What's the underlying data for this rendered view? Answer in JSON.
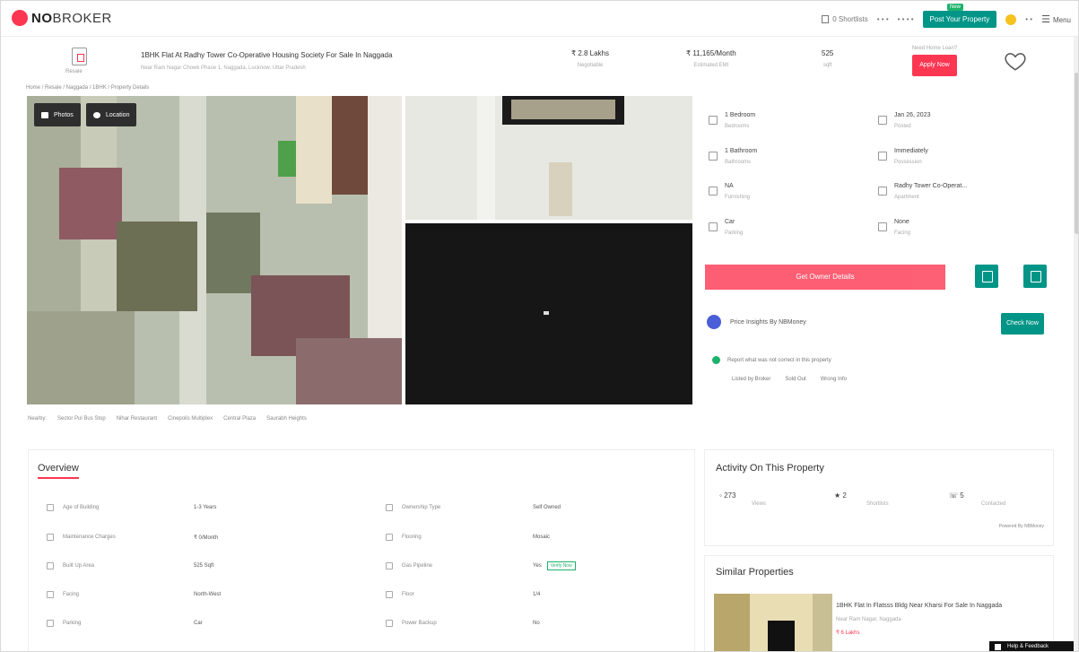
{
  "header": {
    "logo": {
      "brand_prefix": "NO",
      "brand_suffix": "BROKER"
    },
    "shortlist": "0 Shortlists",
    "links": [
      "• • •",
      "• • • •"
    ],
    "post_property": "Post Your Property",
    "new_badge": "New",
    "menu": "Menu"
  },
  "title_bar": {
    "home_label": "Resale",
    "property_title": "1BHK Flat At Radhy Tower Co-Operative Housing Society For Sale In Naggada",
    "property_subtitle": "Near Ram Nagar Chowk Phase 1, Naggada, Lucknow, Uttar Pradesh",
    "price": "₹ 2.8 Lakhs",
    "price_label": "Negotiable",
    "emi": "₹ 11,165/Month",
    "emi_label": "Estimated EMI",
    "area": "525",
    "area_label": "sqft",
    "owner_question": "Need Home Loan?",
    "owner_button": "Apply Now"
  },
  "breadcrumb": "Home / Resale / Naggada / 1BHK / Property Details",
  "gallery": {
    "photos_button": "Photos",
    "location_button": "Location"
  },
  "landmarks": [
    "Nearby:",
    "Sector Pul Bus Stop",
    "Nihar Restaurant",
    "Cinepolis Multiplex",
    "Central Plaza",
    "Saurabh Heights"
  ],
  "details": [
    {
      "icon": "bed-icon",
      "value": "1 Bedroom",
      "label": "Bedrooms"
    },
    {
      "icon": "calendar-icon",
      "value": "Jan 26, 2023",
      "label": "Posted"
    },
    {
      "icon": "bath-icon",
      "value": "1 Bathroom",
      "label": "Bathrooms"
    },
    {
      "icon": "clock-icon",
      "value": "Immediately",
      "label": "Possession"
    },
    {
      "icon": "sofa-icon",
      "value": "NA",
      "label": "Furnishing"
    },
    {
      "icon": "building-icon",
      "value": "Radhy Tower Co-Operat...",
      "label": "Apartment"
    },
    {
      "icon": "car-icon",
      "value": "Car",
      "label": "Parking"
    },
    {
      "icon": "compass-icon",
      "value": "None",
      "label": "Facing"
    }
  ],
  "contact_button": "Get Owner Details",
  "nbmoney": {
    "text": "Price Insights By NBMoney",
    "button": "Check Now"
  },
  "report": {
    "text": "Report what was not correct in this property",
    "options": [
      "Listed by Broker",
      "Sold Out",
      "Wrong Info"
    ]
  },
  "overview": {
    "title": "Overview",
    "rows": [
      {
        "left_label": "Age of Building",
        "left_value": "1-3 Years",
        "right_label": "Ownership Type",
        "right_value": "Self Owned"
      },
      {
        "left_label": "Maintenance Charges",
        "left_value": "₹ 0/Month",
        "right_label": "Flooring",
        "right_value": "Mosaic"
      },
      {
        "left_label": "Built Up Area",
        "left_value": "525 Sqft",
        "right_label": "Gas Pipeline",
        "right_value": "Yes",
        "verify": "Verify Now"
      },
      {
        "left_label": "Facing",
        "left_value": "North-West",
        "right_label": "Floor",
        "right_value": "1/4"
      },
      {
        "left_label": "Parking",
        "left_value": "Car",
        "right_label": "Power Backup",
        "right_value": "No"
      }
    ]
  },
  "activity": {
    "title": "Activity On This Property",
    "items": [
      {
        "value": "273",
        "label": "Views"
      },
      {
        "value": "2",
        "label": "Shortlists"
      },
      {
        "value": "5",
        "label": "Contacted"
      }
    ],
    "footer": "Powered By NBMoney"
  },
  "similar": {
    "title": "Similar Properties",
    "name": "1BHK Flat In Flatsss Bldg Near Kharsi For Sale In Naggada",
    "sub": "Near Ram Nagar, Naggada",
    "price": "₹ 6 Lakhs"
  },
  "help": "Help & Feedback",
  "colors": {
    "brand": "#fd3752",
    "accent": "#009587"
  }
}
